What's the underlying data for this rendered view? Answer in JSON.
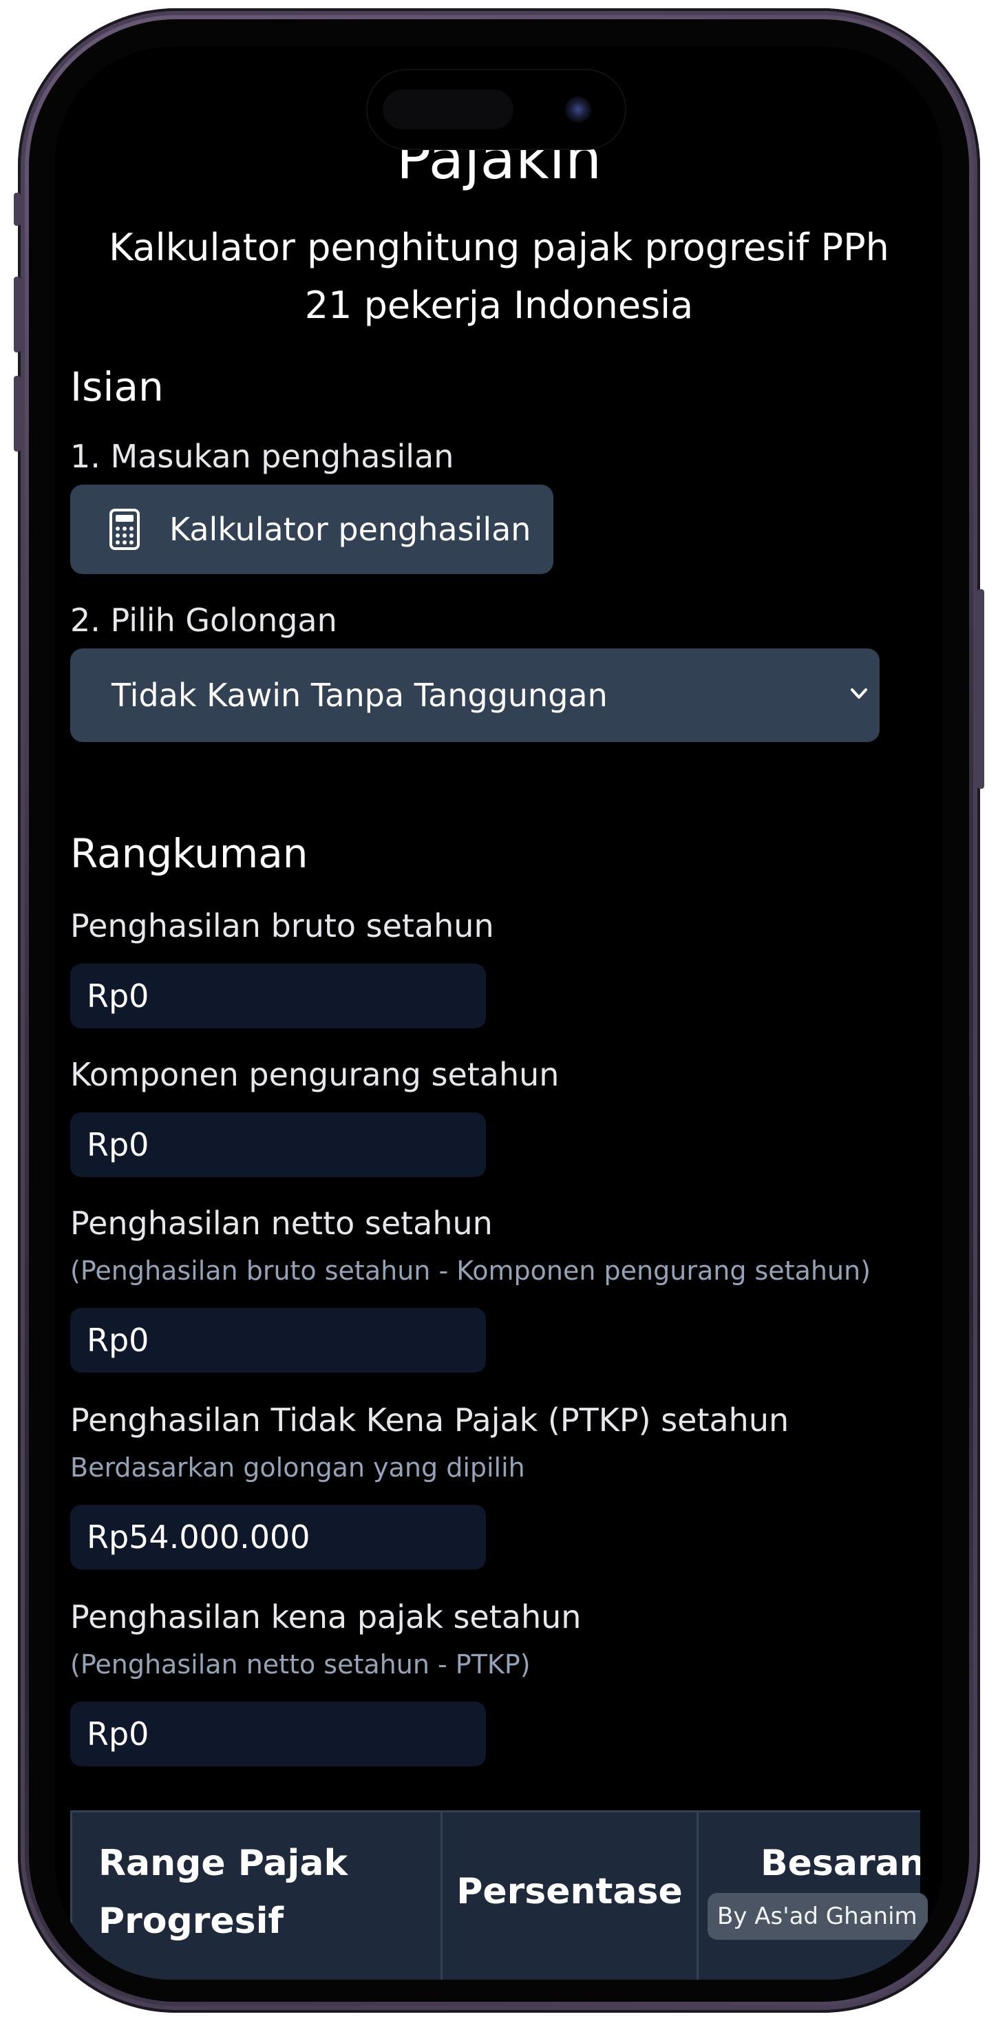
{
  "app": {
    "title": "Pajakin",
    "subtitle": "Kalkulator penghitung pajak progresif PPh 21 pekerja Indonesia"
  },
  "isian": {
    "heading": "Isian",
    "step1_label": "1. Masukan penghasilan",
    "calc_button_label": "Kalkulator penghasilan",
    "calc_button_icon": "calculator-icon",
    "step2_label": "2. Pilih Golongan",
    "golongan_selected": "Tidak Kawin Tanpa Tanggungan",
    "golongan_icon": "chevron-down-icon"
  },
  "rangkuman": {
    "heading": "Rangkuman",
    "items": [
      {
        "label": "Penghasilan bruto setahun",
        "hint": "",
        "value": "Rp0"
      },
      {
        "label": "Komponen pengurang setahun",
        "hint": "",
        "value": "Rp0"
      },
      {
        "label": "Penghasilan netto setahun",
        "hint": "(Penghasilan bruto setahun - Komponen pengurang setahun)",
        "value": "Rp0"
      },
      {
        "label": "Penghasilan Tidak Kena Pajak (PTKP) setahun",
        "hint": "Berdasarkan golongan yang dipilih",
        "value": "Rp54.000.000"
      },
      {
        "label": "Penghasilan kena pajak setahun",
        "hint": "(Penghasilan netto setahun - PTKP)",
        "value": "Rp0"
      }
    ]
  },
  "table": {
    "headers": [
      "Range Pajak Progresif",
      "Persentase",
      "Besaran Pajak"
    ]
  },
  "credit_badge": "By As'ad Ghanim",
  "colors": {
    "background": "#000000",
    "button": "#334155",
    "field": "#0f172a",
    "hint_text": "#94a3b8",
    "table_header": "#1e293b"
  }
}
